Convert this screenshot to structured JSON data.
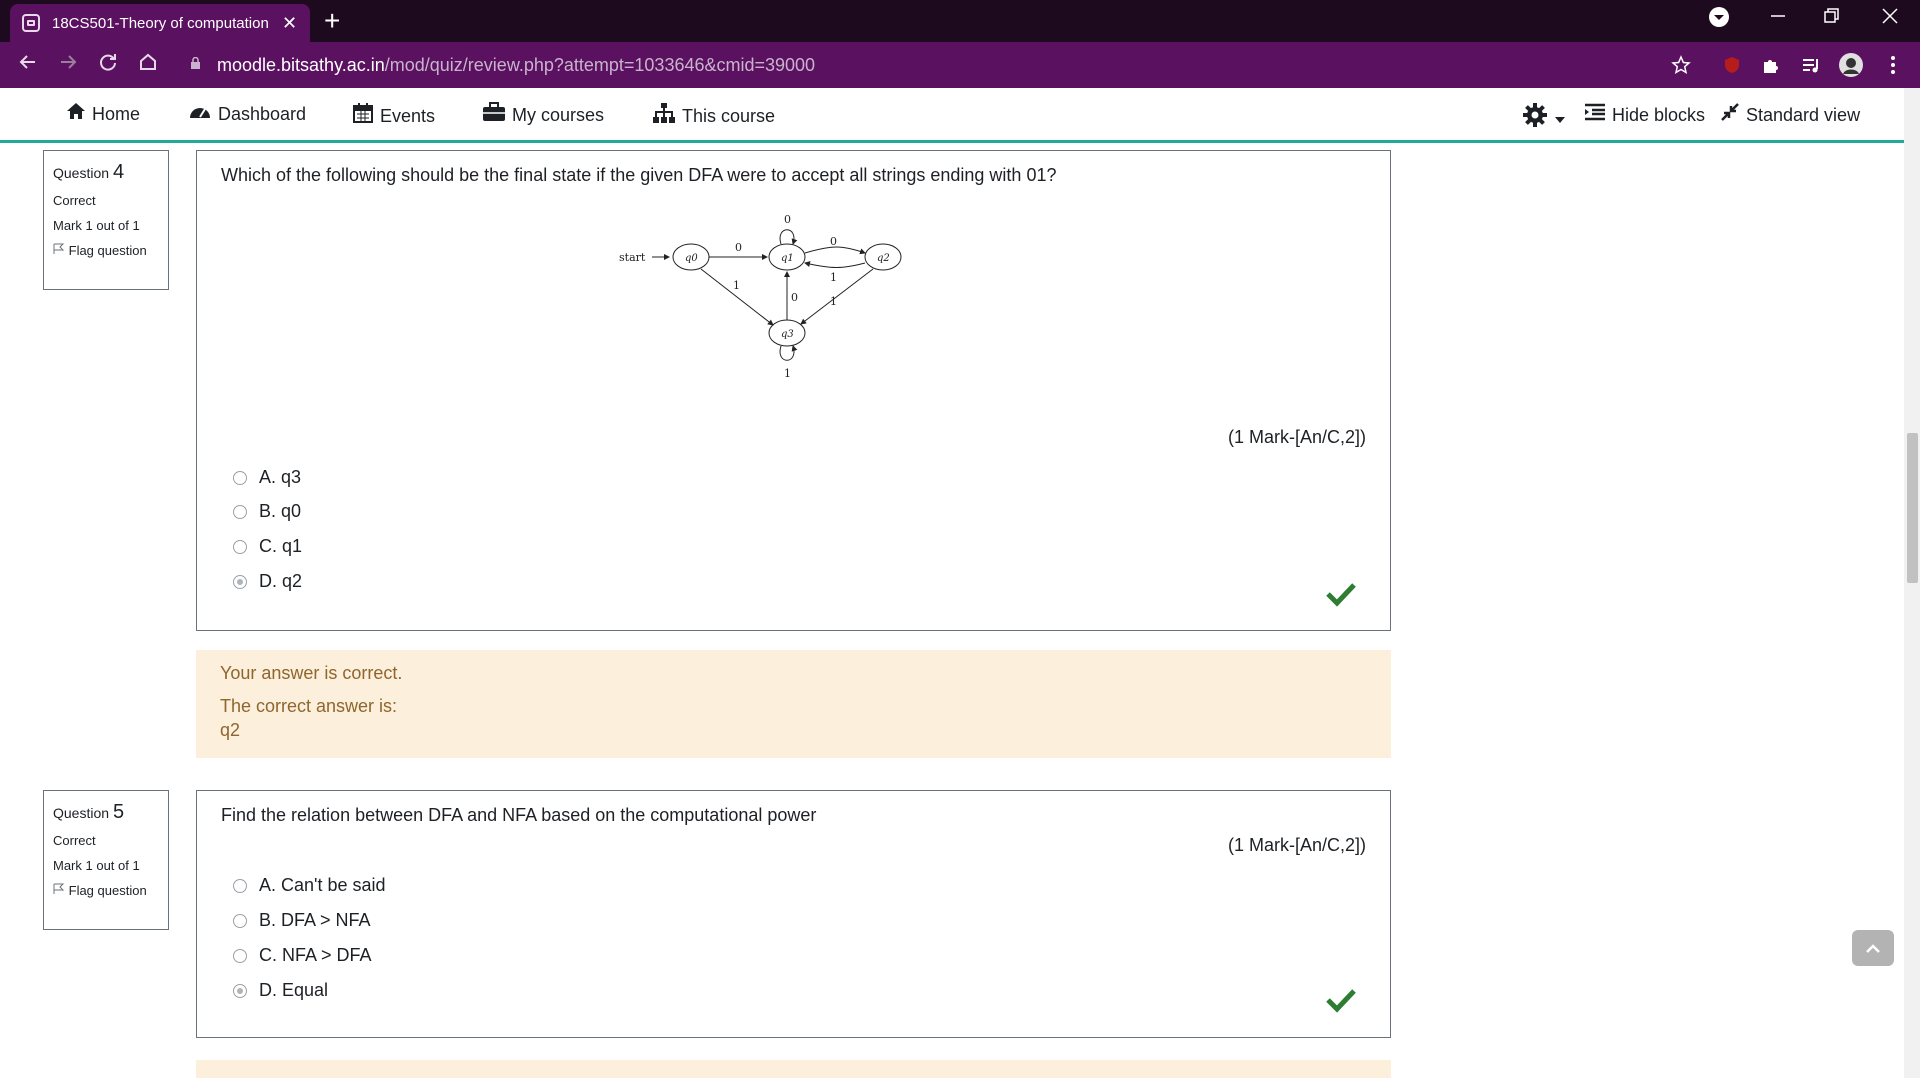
{
  "browser": {
    "tab_title": "18CS501-Theory of computation",
    "tab_close": "✕",
    "new_tab": "+",
    "url_host": "moodle.bitsathy.ac.in",
    "url_path": "/mod/quiz/review.php?attempt=1033646&cmid=39000"
  },
  "navbar": {
    "home": "Home",
    "dashboard": "Dashboard",
    "events": "Events",
    "my_courses": "My courses",
    "this_course": "This course",
    "hide_blocks": "Hide blocks",
    "standard_view": "Standard view"
  },
  "questions": [
    {
      "label": "Question",
      "number": "4",
      "state": "Correct",
      "mark": "Mark 1 out of 1",
      "flag": "Flag question",
      "text": "Which of the following should be the final state if the given DFA were to accept all strings ending with 01?",
      "marks_info": "(1 Mark-[An/C,2])",
      "options": [
        "A. q3",
        "B. q0",
        "C. q1",
        "D. q2"
      ],
      "selected": 3,
      "feedback_1": "Your answer is correct.",
      "feedback_2": "The correct answer is:",
      "feedback_3": "q2",
      "diagram": {
        "start_label": "start",
        "states": [
          "q0",
          "q1",
          "q2",
          "q3"
        ],
        "edge_labels": [
          "0",
          "0",
          "0",
          "1",
          "1",
          "0",
          "1",
          "1"
        ]
      }
    },
    {
      "label": "Question",
      "number": "5",
      "state": "Correct",
      "mark": "Mark 1 out of 1",
      "flag": "Flag question",
      "text": "Find the relation between DFA and NFA based on the computational power",
      "marks_info": "(1 Mark-[An/C,2])",
      "options": [
        "A. Can't be said",
        "B. DFA > NFA",
        "C. NFA > DFA",
        "D. Equal"
      ],
      "selected": 3
    }
  ],
  "colors": {
    "tab_bar": "#1e0a1f",
    "address_bar": "#5a1160",
    "nav_accent": "#1faa9a",
    "feedback_bg": "#fcefdc",
    "feedback_text": "#8e662e",
    "check": "#2e7d32"
  }
}
